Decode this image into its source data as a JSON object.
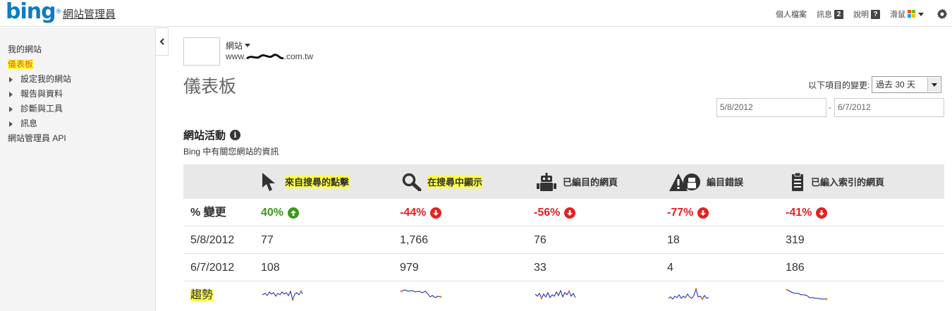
{
  "header": {
    "logo": "bing",
    "app_title": "網站管理員",
    "links": [
      {
        "label": "個人檔案"
      },
      {
        "label": "訊息",
        "badge": "2"
      },
      {
        "label": "說明",
        "badge": "?"
      },
      {
        "label": "滑鼠"
      }
    ]
  },
  "sidebar": {
    "items": [
      {
        "label": "我的網站"
      },
      {
        "label": "儀表板"
      },
      {
        "label": "設定我的網站"
      },
      {
        "label": "報告與資料"
      },
      {
        "label": "診斷與工具"
      },
      {
        "label": "訊息"
      },
      {
        "label": "網站管理員 API"
      }
    ]
  },
  "site": {
    "label": "網站",
    "url_prefix": "www.",
    "url_suffix": ".com.tw"
  },
  "page_title": "儀表板",
  "range": {
    "label": "以下項目的變更:",
    "selected": "過去 30 天",
    "start_date": "5/8/2012",
    "end_date": "6/7/2012",
    "separator": "-"
  },
  "section": {
    "title": "網站活動",
    "subtitle": "Bing 中有關您網站的資訊"
  },
  "table": {
    "columns": [
      {
        "label": "來自搜尋的點擊",
        "icon": "cursor-icon"
      },
      {
        "label": "在搜尋中顯示",
        "icon": "magnifier-icon"
      },
      {
        "label": "已編目的網頁",
        "icon": "robot-icon"
      },
      {
        "label": "編目錯誤",
        "icon": "warning-robot-icon"
      },
      {
        "label": "已編入索引的網頁",
        "icon": "clipboard-icon"
      }
    ],
    "change_label": "% 變更",
    "changes": [
      "40%",
      "-44%",
      "-56%",
      "-77%",
      "-41%"
    ],
    "change_direction": [
      "up",
      "down",
      "down",
      "down",
      "down"
    ],
    "rows": [
      {
        "label": "5/8/2012",
        "values": [
          "77",
          "1,766",
          "76",
          "18",
          "319"
        ]
      },
      {
        "label": "6/7/2012",
        "values": [
          "108",
          "979",
          "33",
          "4",
          "186"
        ]
      }
    ],
    "trend_label": "趨勢"
  },
  "colors": {
    "bing_blue": "#0e7ac4",
    "up": "#3a9a1c",
    "down": "#e32121",
    "highlight": "#ffff44",
    "sparkline": "#1a1ab8"
  }
}
